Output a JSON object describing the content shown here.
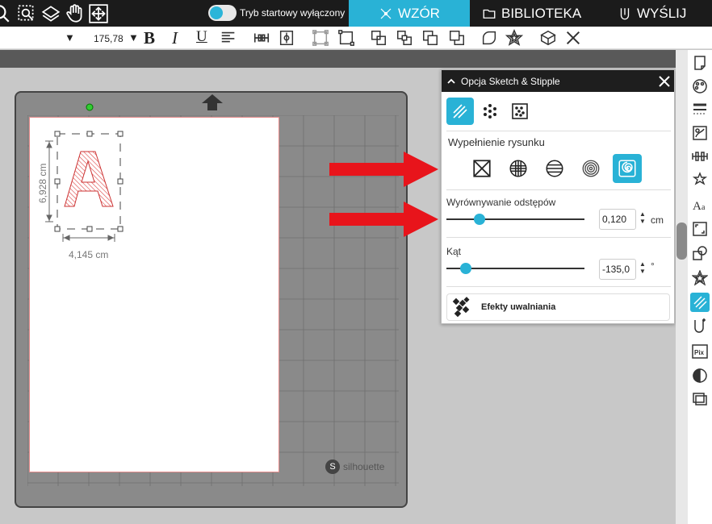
{
  "topbar": {
    "startup_label": "Tryb startowy wyłączony",
    "tabs": [
      {
        "label": "WZÓR",
        "icon": "design-icon",
        "active": true
      },
      {
        "label": "BIBLIOTEKA",
        "icon": "folder-icon",
        "active": false
      },
      {
        "label": "WYŚLIJ",
        "icon": "send-icon",
        "active": false
      }
    ],
    "accent_color": "#29b2d6"
  },
  "toolbar": {
    "font_size": "175,78"
  },
  "canvas": {
    "selection_width": "4,145 cm",
    "selection_height": "6,928 cm",
    "letter": "A",
    "brand": "silhouette"
  },
  "panel": {
    "title": "Opcja Sketch & Stipple",
    "fill_heading": "Wypełnienie rysunku",
    "spacing_label": "Wyrównywanie odstępów",
    "spacing_value": "0,120",
    "spacing_unit": "cm",
    "spacing_level": 0.24,
    "angle_label": "Kąt",
    "angle_value": "-135,0",
    "angle_unit": "°",
    "angle_level": 0.14,
    "release_label": "Efekty uwalniania"
  }
}
